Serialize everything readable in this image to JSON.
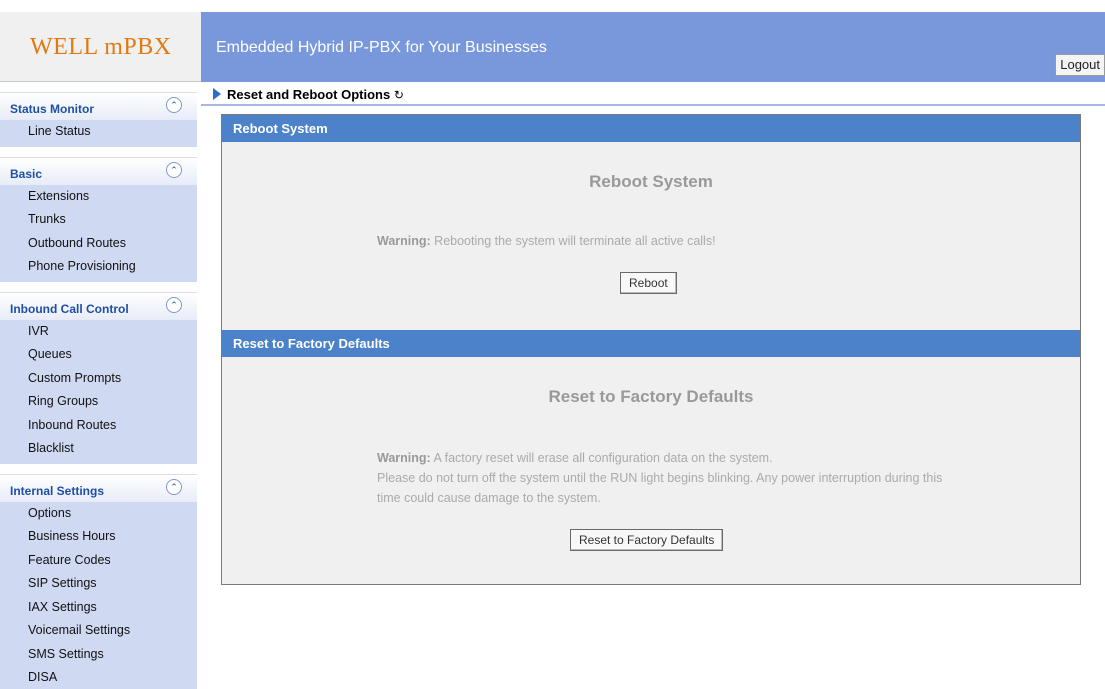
{
  "app": {
    "logo": "WELL mPBX",
    "header_title": "Embedded Hybrid IP-PBX for Your Businesses",
    "logout_label": "Logout"
  },
  "sidebar": {
    "sections": [
      {
        "title": "Status Monitor",
        "items": [
          "Line Status"
        ]
      },
      {
        "title": "Basic",
        "items": [
          "Extensions",
          "Trunks",
          "Outbound Routes",
          "Phone Provisioning"
        ]
      },
      {
        "title": "Inbound Call Control",
        "items": [
          "IVR",
          "Queues",
          "Custom Prompts",
          "Ring Groups",
          "Inbound Routes",
          "Blacklist"
        ]
      },
      {
        "title": "Internal Settings",
        "items": [
          "Options",
          "Business Hours",
          "Feature Codes",
          "SIP Settings",
          "IAX Settings",
          "Voicemail Settings",
          "SMS Settings",
          "DISA"
        ]
      }
    ]
  },
  "breadcrumb": {
    "label": "Reset and Reboot Options",
    "refresh_icon": "↻"
  },
  "reboot": {
    "bar_title": "Reboot System",
    "heading": "Reboot System",
    "warning_label": "Warning:",
    "warning_text": " Rebooting the system will terminate all active calls!",
    "button_label": "Reboot"
  },
  "reset": {
    "bar_title": "Reset to Factory Defaults",
    "heading": "Reset to Factory Defaults",
    "warning_label": "Warning:",
    "warning_text": " A factory reset will erase all configuration data on the system.",
    "line2": "Please do not turn off the system until the RUN light begins blinking. Any power interruption during this",
    "line3": "time could cause damage to the system.",
    "button_label": "Reset to Factory Defaults"
  },
  "colors": {
    "header": "#7898db",
    "panel_bar": "#4c82c9",
    "sidebar_items": "#cfd9f2",
    "logo": "#e07a10"
  }
}
